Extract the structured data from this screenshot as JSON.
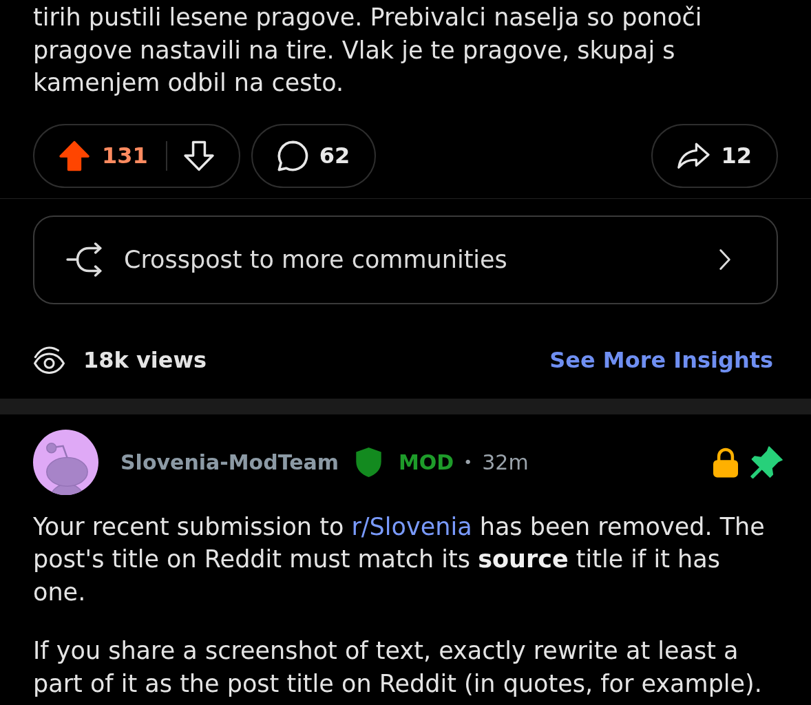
{
  "post": {
    "body": "tirih pustili lesene pragove. Prebivalci naselja so ponoči pragove nastavili na tire. Vlak je te pragove, skupaj s kamenjem odbil na cesto.",
    "upvoted": true,
    "score": "131",
    "comments": "62",
    "shares": "12",
    "crosspost": {
      "label": "Crosspost to more communities"
    },
    "views": "18k views",
    "insights_link": "See More Insights"
  },
  "comment": {
    "author": "Slovenia-ModTeam",
    "badge": "MOD",
    "separator": "•",
    "time": "32m",
    "locked": true,
    "pinned": true,
    "paragraphs": [
      {
        "segments": [
          {
            "kind": "text",
            "text": "Your recent submission to "
          },
          {
            "kind": "link",
            "text": "r/Slovenia"
          },
          {
            "kind": "text",
            "text": " has been removed. The post's title on Reddit must match its **source** title if it has one."
          }
        ]
      },
      {
        "segments": [
          {
            "kind": "text",
            "text": "If you share a screenshot of text, exactly rewrite at least a part of it as the post title on Reddit (in quotes, for example)."
          }
        ]
      }
    ]
  }
}
